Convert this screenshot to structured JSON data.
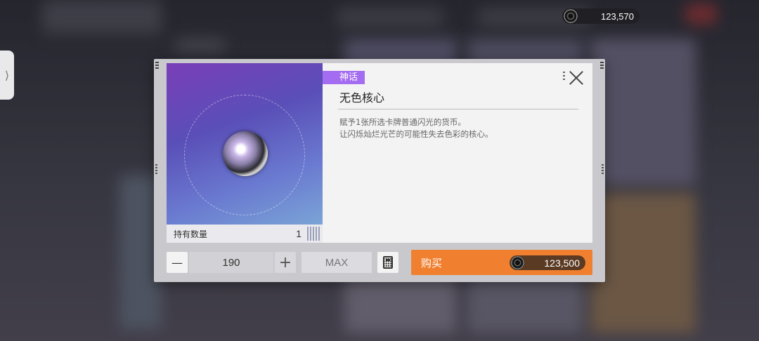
{
  "currency": {
    "balance": "123,570",
    "icon": "currency-coin-icon"
  },
  "side_tab": {
    "icon": "chevron-right-icon",
    "glyph": "⟩"
  },
  "item": {
    "rarity": "神话",
    "name": "无色核心",
    "description": "赋予1张所选卡牌普通闪光的货币。\n让闪烁灿烂光芒的可能性失去色彩的核心。",
    "owned_label": "持有数量",
    "owned_value": "1"
  },
  "purchase": {
    "quantity": "190",
    "minus_glyph": "—",
    "plus_glyph": "+",
    "max_label": "MAX",
    "buy_label": "购买",
    "price": "123,500"
  },
  "colors": {
    "rarity_mythic": "#a46cf0",
    "buy_button": "#f08030"
  }
}
